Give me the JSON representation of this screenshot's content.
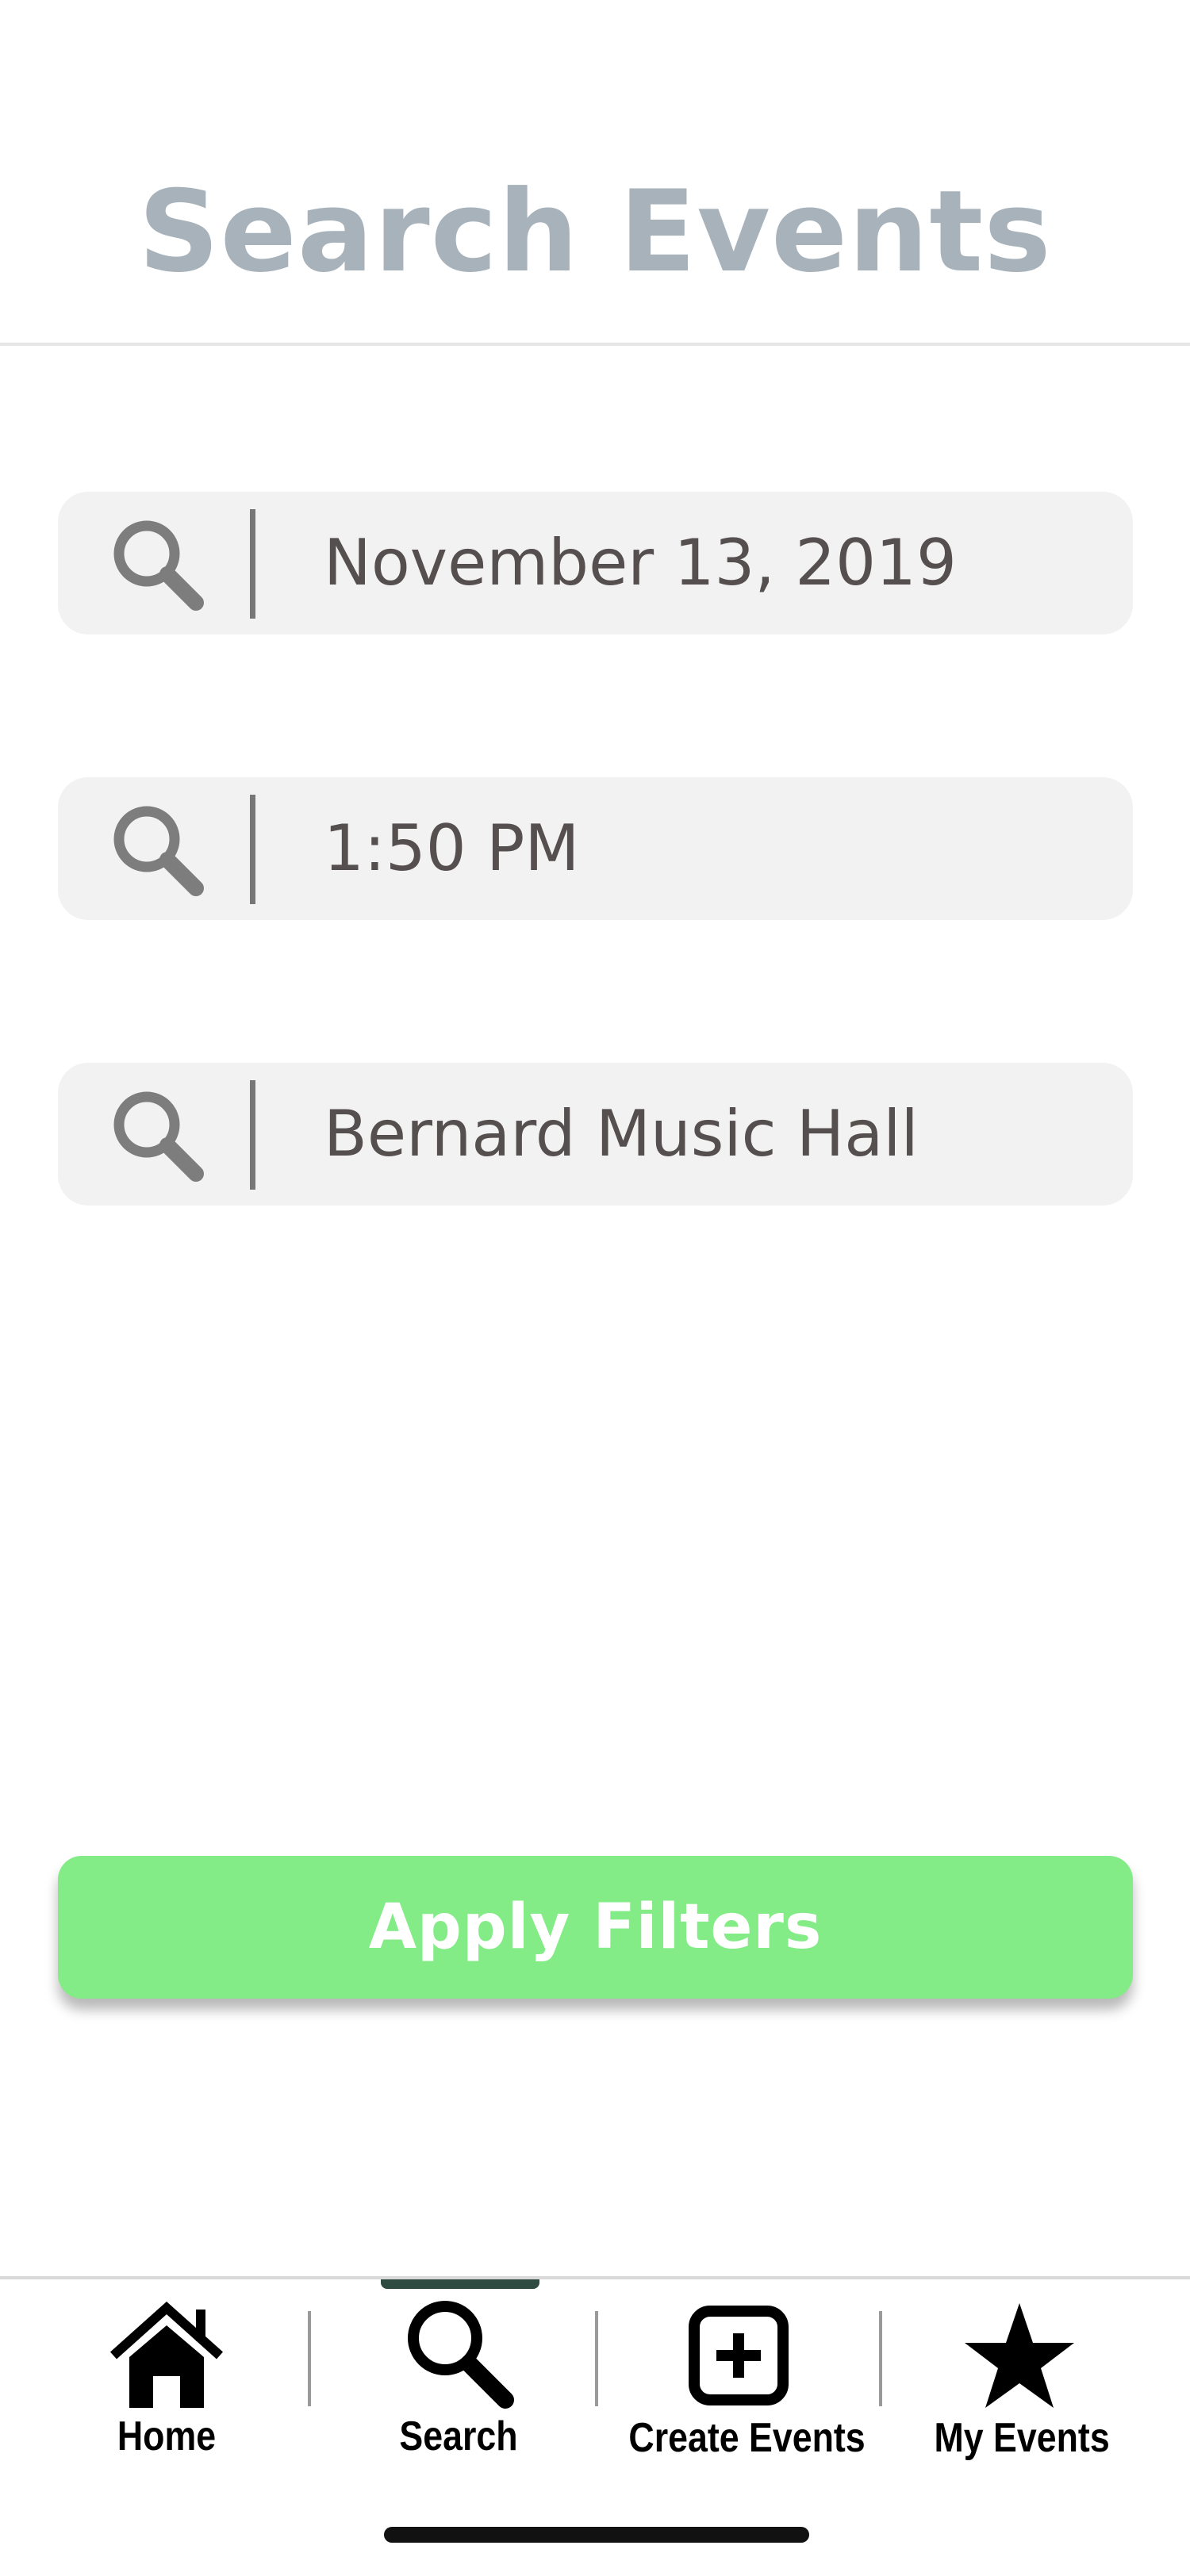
{
  "header": {
    "title": "Search Events"
  },
  "filters": [
    {
      "icon": "search-icon",
      "value": "November 13, 2019"
    },
    {
      "icon": "search-icon",
      "value": "1:50 PM"
    },
    {
      "icon": "search-icon",
      "value": "Bernard Music Hall"
    }
  ],
  "apply_button": {
    "label": "Apply Filters",
    "color": "#84ec86"
  },
  "tab_bar": {
    "active": "Search",
    "tabs": [
      {
        "label": "Home",
        "icon": "home-icon"
      },
      {
        "label": "Search",
        "icon": "search-icon"
      },
      {
        "label": "Create Events",
        "icon": "plus-square-icon"
      },
      {
        "label": "My Events",
        "icon": "star-icon"
      }
    ]
  },
  "colors": {
    "title": "#a7b2bb",
    "field_background": "#f2f2f2",
    "field_text": "#564f4f",
    "active_tab_indicator": "#2f4a41"
  }
}
